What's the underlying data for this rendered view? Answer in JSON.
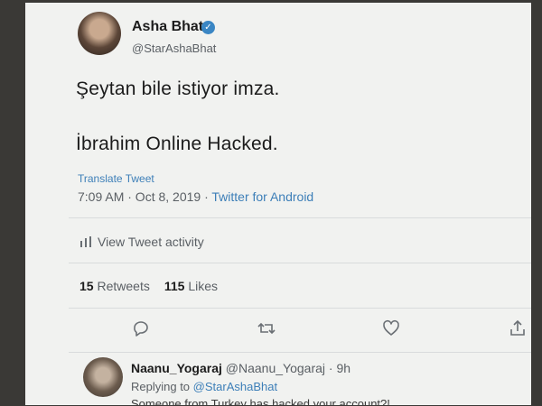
{
  "tweet": {
    "author_name": "Asha Bhat",
    "author_handle": "@StarAshaBhat",
    "verified_mark": "✓",
    "text_line_1": "Şeytan bile istiyor imza.",
    "text_line_2": "İbrahim Online Hacked.",
    "translate_label": "Translate Tweet",
    "timestamp": "7:09 AM · Oct 8, 2019",
    "meta_separator": " · ",
    "source": "Twitter for Android",
    "activity_label": "View Tweet activity",
    "retweets_count": "15",
    "retweets_label": "Retweets",
    "likes_count": "115",
    "likes_label": "Likes"
  },
  "reply": {
    "author_name": "Naanu_Yogaraj",
    "author_handle": "@Naanu_Yogaraj",
    "time": "· 9h",
    "replying_to_label": "Replying to",
    "replying_to_handle": "@StarAshaBhat",
    "text": "Someone from Turkey has hacked your account?!"
  },
  "icons": {
    "avatar": "avatar",
    "verified": "verified-badge-icon",
    "activity": "bar-chart-icon",
    "reply": "reply-icon",
    "retweet": "retweet-icon",
    "like": "heart-icon",
    "share": "share-icon"
  },
  "colors": {
    "link_blue": "#3d7fb8",
    "verified_blue": "#3a86c4",
    "screen_bg": "#f1f2f0"
  }
}
